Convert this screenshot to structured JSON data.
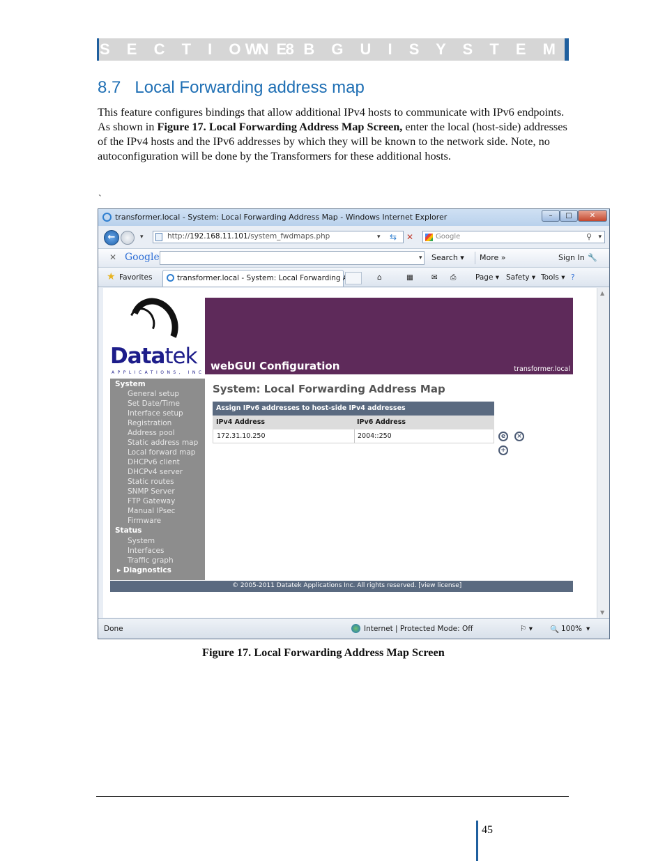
{
  "header": {
    "section_label": "S E C T I O N 8",
    "section_title": "W E B G U I S Y S T E M"
  },
  "heading": {
    "number": "8.7",
    "title": "Local Forwarding address map"
  },
  "body": {
    "p1": "This feature configures bindings that allow additional IPv4 hosts to communicate with IPv6 endpoints. As shown in ",
    "p1_bold": "Figure 17. Local Forwarding Address Map Screen,",
    "p1_rest": " enter the local (host-side) addresses of the IPv4 hosts and the IPv6 addresses by which they will be known to the network side. Note, no autoconfiguration will be done by the Transformers for these additional hosts.",
    "stray_mark": "`"
  },
  "browser": {
    "window_title": "transformer.local - System: Local Forwarding Address Map - Windows Internet Explorer",
    "window_buttons": {
      "minimize": "–",
      "maximize": "□",
      "close": "✕"
    },
    "url_prefix": "http://",
    "url_host": "192.168.11.101",
    "url_path": "/system_fwdmaps.php",
    "search_placeholder": "Google",
    "google_bar": {
      "close": "✕",
      "logo": "Google",
      "search": "Search ▾",
      "more": "More »",
      "sign_in": "Sign In"
    },
    "favorites": "Favorites",
    "tab_title": "transformer.local - System: Local Forwarding Ad...",
    "commands": [
      "Page ▾",
      "Safety ▾",
      "Tools ▾"
    ],
    "status": {
      "left": "Done",
      "zone": "Internet | Protected Mode: Off",
      "zoom": "100%"
    }
  },
  "webgui": {
    "logo_main": "Data",
    "logo_tek": "tek",
    "logo_sub": "APPLICATIONS, INC",
    "banner_title": "webGUI Configuration",
    "host": "transformer.local",
    "sidebar": {
      "system": "System",
      "system_items": [
        "General setup",
        "Set Date/Time",
        "Interface setup",
        "Registration",
        "Address pool",
        "Static address map",
        "Local forward map",
        "DHCPv6 client",
        "DHCPv4 server",
        "Static routes",
        "SNMP Server",
        "FTP Gateway",
        "Manual IPsec",
        "Firmware"
      ],
      "status": "Status",
      "status_items": [
        "System",
        "Interfaces",
        "Traffic graph"
      ],
      "diagnostics": "▸ Diagnostics"
    },
    "page_title": "System: Local Forwarding Address Map",
    "table": {
      "caption": "Assign IPv6 addresses to host-side IPv4 addresses",
      "col1": "IPv4 Address",
      "col2": "IPv6 Address",
      "rows": [
        {
          "ipv4": "172.31.10.250",
          "ipv6": "2004::250"
        }
      ]
    },
    "icons": {
      "edit": "e",
      "delete": "×",
      "add": "+"
    },
    "footer": "© 2005-2011 Datatek Applications Inc. All rights reserved.  [view license]"
  },
  "figure_caption": "Figure 17. Local Forwarding Address Map Screen",
  "page_number": "45"
}
